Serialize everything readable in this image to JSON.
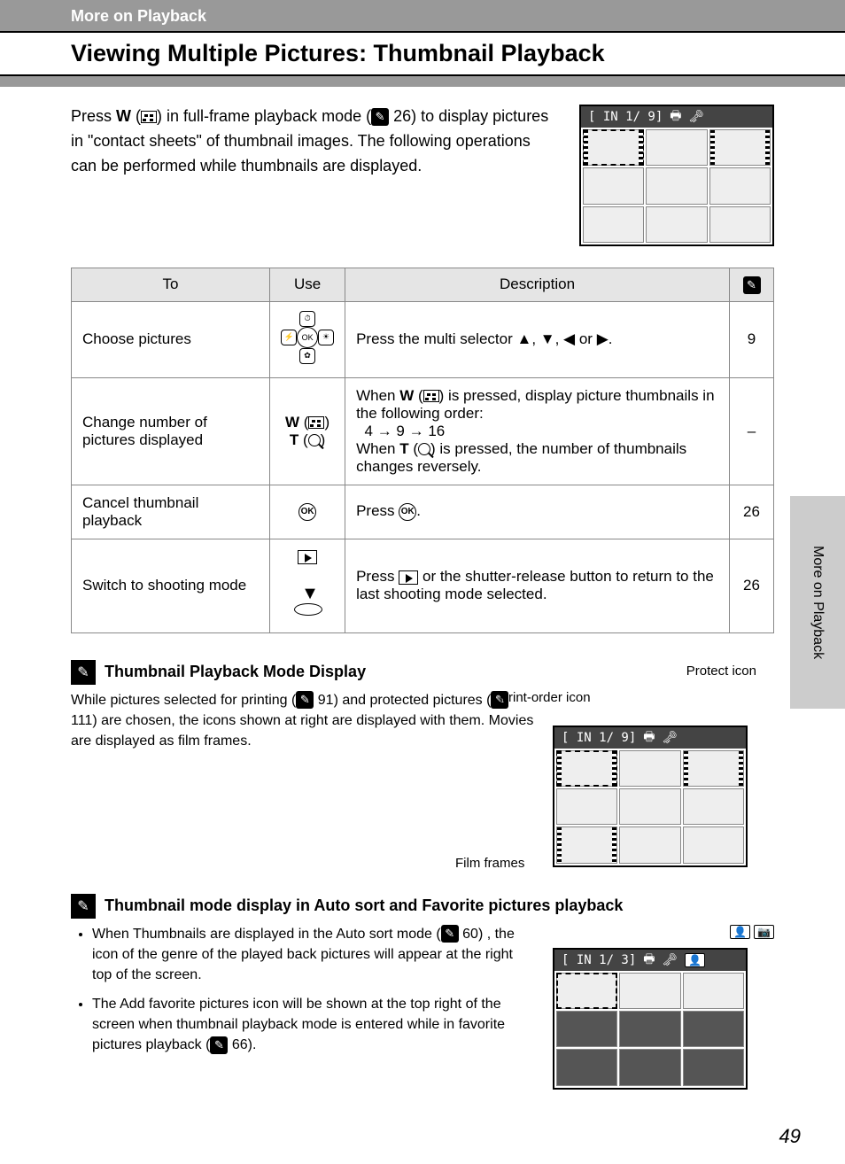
{
  "breadcrumb": "More on Playback",
  "title": "Viewing Multiple Pictures: Thumbnail Playback",
  "intro": "Press W (thumbnail) in full-frame playback mode (see 26) to display pictures in \"contact sheets\" of thumbnail images. The following operations can be performed while thumbnails are displayed.",
  "thumb_bar_1": "[ IN  1/  9]",
  "table": {
    "headers": {
      "to": "To",
      "use": "Use",
      "desc": "Description",
      "ref": ""
    },
    "rows": [
      {
        "to": "Choose pictures",
        "use_type": "multiselector",
        "desc": "Press the multi selector ▲, ▼, ◀ or ▶.",
        "ref": "9"
      },
      {
        "to": "Change number of pictures displayed",
        "use_type": "wt",
        "use_label_w": "W",
        "use_label_t": "T",
        "desc": "When W (thumbnail) is pressed, display picture thumbnails in the following order:\n  4 → 9 → 16\nWhen T (zoom) is pressed, the number of thumbnails changes reversely.",
        "ref": "–"
      },
      {
        "to": "Cancel thumbnail playback",
        "use_type": "ok",
        "desc": "Press OK.",
        "ref": "26"
      },
      {
        "to": "Switch to shooting mode",
        "use_type": "play_shutter",
        "desc": "Press ▶ or the shutter-release button to return to the last shooting mode selected.",
        "ref": "26"
      }
    ]
  },
  "note1": {
    "title": "Thumbnail Playback Mode Display",
    "text": "While pictures selected for printing (see 91) and protected pictures (see 111) are chosen, the icons shown at right are displayed with them. Movies are displayed as film frames.",
    "callout_print": "Print-order icon",
    "callout_protect": "Protect icon",
    "callout_film": "Film frames",
    "bar": "[ IN  1/  9]"
  },
  "note2": {
    "title": "Thumbnail mode display in Auto sort and Favorite pictures playback",
    "bullet1": "When Thumbnails are displayed in the Auto sort mode (see 60) , the icon of the genre of the played back pictures will appear at the right top of the screen.",
    "bullet2": "The Add favorite pictures icon will be shown at the top right of the screen when thumbnail playback mode is entered while in favorite pictures playback (see 66).",
    "bar": "[ IN  1/  3]"
  },
  "side_tab": "More on Playback",
  "page_number": "49"
}
